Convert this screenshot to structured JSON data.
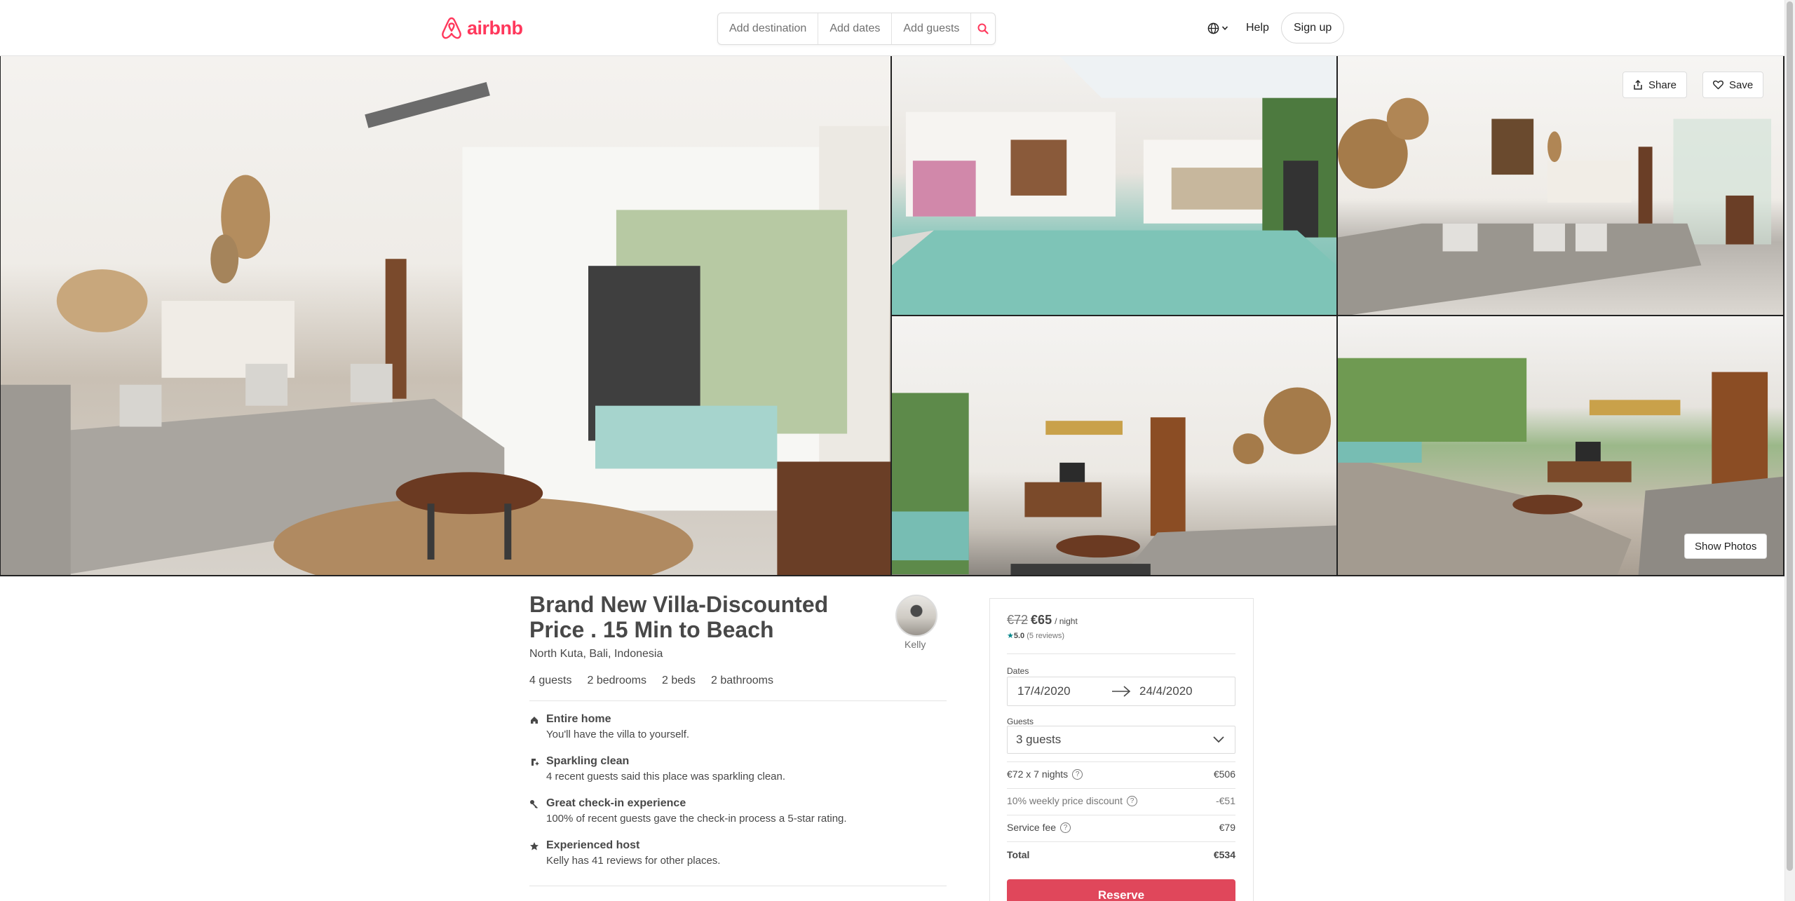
{
  "header": {
    "logo_text": "airbnb",
    "search": {
      "destination_placeholder": "Add destination",
      "dates_placeholder": "Add dates",
      "guests_placeholder": "Add guests"
    },
    "help_label": "Help",
    "signup_label": "Sign up",
    "brand_color": "#ff385c"
  },
  "photos": {
    "share_label": "Share",
    "save_label": "Save",
    "show_photos_label": "Show Photos"
  },
  "listing": {
    "title": "Brand New Villa-Discounted Price . 15 Min to Beach",
    "location": "North Kuta, Bali, Indonesia",
    "host_name": "Kelly",
    "facts": [
      "4 guests",
      "2 bedrooms",
      "2 beds",
      "2 bathrooms"
    ],
    "highlights": [
      {
        "icon": "home-icon",
        "title": "Entire home",
        "desc": "You'll have the villa to yourself."
      },
      {
        "icon": "sparkle-icon",
        "title": "Sparkling clean",
        "desc": "4 recent guests said this place was sparkling clean."
      },
      {
        "icon": "key-icon",
        "title": "Great check-in experience",
        "desc": "100% of recent guests gave the check-in process a 5-star rating."
      },
      {
        "icon": "star-icon",
        "title": "Experienced host",
        "desc": "Kelly has 41 reviews for other places."
      }
    ]
  },
  "booking": {
    "old_price": "€72",
    "price": "€65",
    "per_night": "/ night",
    "rating": "5.0",
    "reviews": "(5 reviews)",
    "dates_label": "Dates",
    "check_in": "17/4/2020",
    "check_out": "24/4/2020",
    "guests_label": "Guests",
    "guests_value": "3 guests",
    "lines": [
      {
        "label": "€72 x 7 nights",
        "value": "€506",
        "muted": false,
        "help": true
      },
      {
        "label": "10% weekly price discount",
        "value": "-€51",
        "muted": true,
        "help": true
      },
      {
        "label": "Service fee",
        "value": "€79",
        "muted": false,
        "help": true
      },
      {
        "label": "Total",
        "value": "€534",
        "muted": false,
        "help": false
      }
    ],
    "reserve_label": "Reserve",
    "accent_color": "#e0475b"
  }
}
